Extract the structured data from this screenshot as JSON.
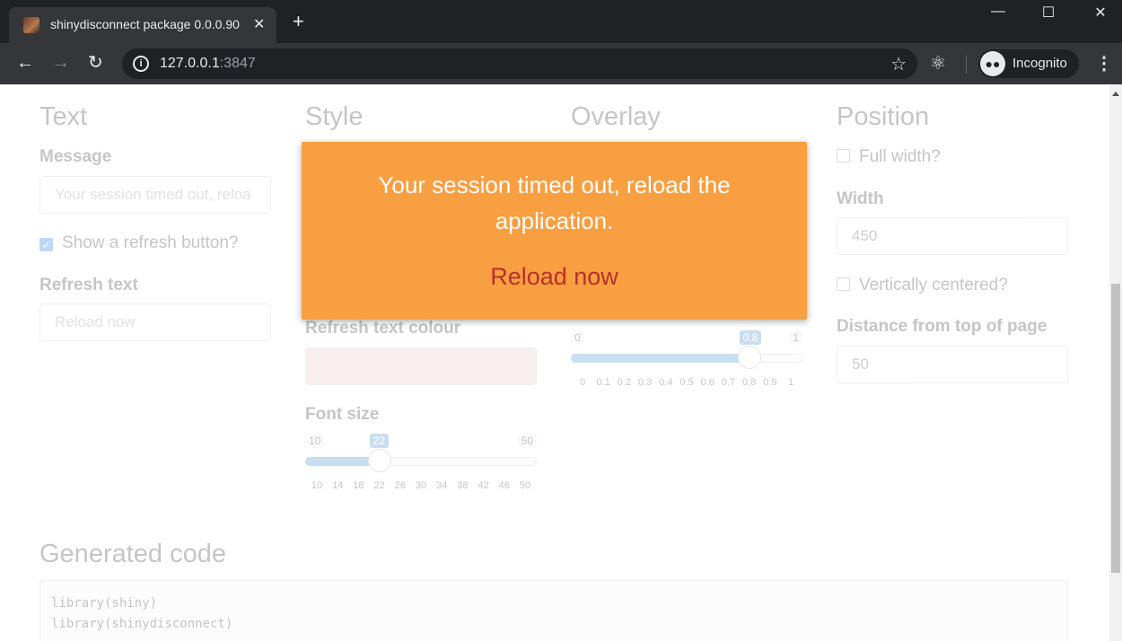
{
  "browser": {
    "tab_title": "shinydisconnect package 0.0.0.90",
    "url_host": "127.0.0.1",
    "url_port": ":3847",
    "incognito_label": "Incognito",
    "new_tab_glyph": "+",
    "close_tab_glyph": "✕"
  },
  "sections": {
    "text": {
      "heading": "Text",
      "message_label": "Message",
      "message_placeholder": "Your session timed out, reloa",
      "show_refresh_label": "Show a refresh button?",
      "show_refresh_checked": true,
      "refresh_text_label": "Refresh text",
      "refresh_text_placeholder": "Reload now"
    },
    "style": {
      "heading": "Style",
      "refresh_colour_label": "Refresh text colour",
      "refresh_colour_value": "#e8c4c4",
      "font_size_label": "Font size",
      "font_size": {
        "min": "10",
        "max": "50",
        "value": "22",
        "value_fraction": 0.3,
        "ticks": [
          "10",
          "14",
          "18",
          "22",
          "26",
          "30",
          "34",
          "38",
          "42",
          "46",
          "50"
        ]
      }
    },
    "overlay": {
      "heading": "Overlay",
      "opacity": {
        "min": "0",
        "max": "1",
        "value": "0.8",
        "value_fraction": 0.8,
        "ticks": [
          "0",
          "0.1",
          "0.2",
          "0.3",
          "0.4",
          "0.5",
          "0.6",
          "0.7",
          "0.8",
          "0.9",
          "1"
        ]
      }
    },
    "position": {
      "heading": "Position",
      "full_width_label": "Full width?",
      "width_label": "Width",
      "width_placeholder": "450",
      "vcenter_label": "Vertically centered?",
      "distance_label": "Distance from top of page",
      "distance_placeholder": "50"
    }
  },
  "generated": {
    "heading": "Generated code",
    "lines": [
      "library(shiny)",
      "library(shinydisconnect)"
    ]
  },
  "disconnect": {
    "message": "Your session timed out, reload the application.",
    "reload_label": "Reload now",
    "background": "#f89f42",
    "reload_color": "#b8302a"
  }
}
